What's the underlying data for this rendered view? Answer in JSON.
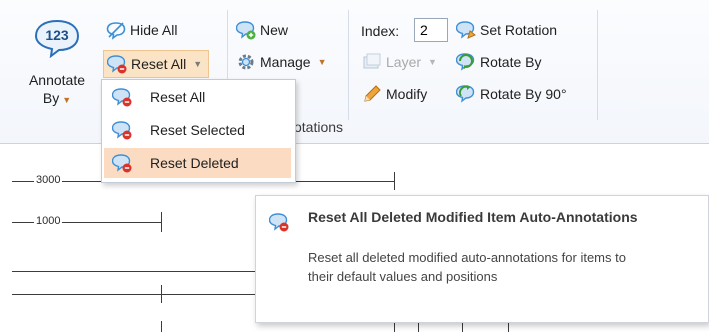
{
  "ribbon": {
    "annotate_by": {
      "label_line1": "Annotate",
      "label_line2": "By",
      "icon_text": "123"
    },
    "hide_all": "Hide All",
    "reset_all": "Reset All",
    "group_label_partial": "otations",
    "new": "New",
    "manage": "Manage",
    "index_label": "Index:",
    "index_value": "2",
    "layer": "Layer",
    "modify": "Modify",
    "set_rotation": "Set Rotation",
    "rotate_by": "Rotate By",
    "rotate_by_90": "Rotate By 90°"
  },
  "reset_menu": {
    "items": [
      {
        "label": "Reset All"
      },
      {
        "label": "Reset Selected"
      },
      {
        "label": "Reset Deleted"
      }
    ]
  },
  "canvas": {
    "dim1": "3000",
    "dim2": "1000"
  },
  "tooltip": {
    "title": "Reset All Deleted Modified Item Auto-Annotations",
    "body": "Reset all deleted modified auto-annotations for items to their default values and positions"
  },
  "colors": {
    "menu_highlight": "#fbdcc2",
    "ribbon_bg": "#f3f6fb",
    "icon_blue": "#3f8fd6",
    "icon_red": "#d9342b"
  }
}
